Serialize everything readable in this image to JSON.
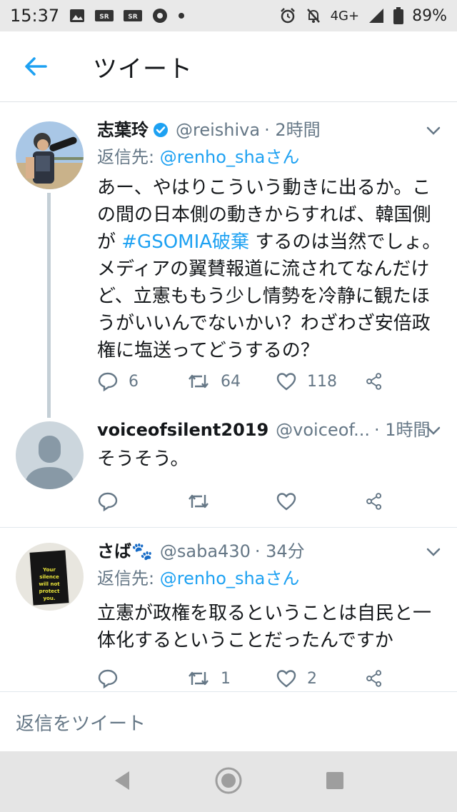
{
  "status_bar": {
    "time": "15:37",
    "network": "4G+",
    "battery": "89%",
    "left_icons": [
      "image-icon",
      "news-app-icon",
      "news-app-icon",
      "chrome-icon",
      "dot-icon"
    ],
    "right_icons": [
      "alarm-icon",
      "mute-icon",
      "signal-icon",
      "battery-icon"
    ]
  },
  "header": {
    "title": "ツイート"
  },
  "tweets": [
    {
      "name": "志葉玲",
      "verified": true,
      "handle": "@reishiva",
      "time": "· 2時間",
      "reply_prefix": "返信先:",
      "reply_to": "@renho_shaさん",
      "text_before": "あー、やはりこういう動きに出るか。この間の日本側の動きからすれば、韓国側が ",
      "hashtag": "#GSOMIA破棄",
      "text_after": " するのは当然でしょ。メディアの翼賛報道に流されてなんだけど、立憲ももう少し情勢を冷静に観たほうがいいんでないかい？わざわざ安倍政権に塩送ってどうするの？",
      "replies": "6",
      "retweets": "64",
      "likes": "118"
    },
    {
      "name": "voiceofsilent2019",
      "handle": "@voiceof...",
      "time": "· 1時間",
      "text": "そうそう。",
      "replies": "",
      "retweets": "",
      "likes": ""
    },
    {
      "name": "さば🐾",
      "handle": "@saba430",
      "time": "· 34分",
      "reply_prefix": "返信先:",
      "reply_to": "@renho_shaさん",
      "text": "立憲が政権を取るということは自民と一体化するということだったんですか",
      "avatar_text": "Your silence will not protect you.",
      "replies": "",
      "retweets": "1",
      "likes": "2"
    }
  ],
  "compose": {
    "placeholder": "返信をツイート"
  },
  "colors": {
    "accent": "#1da1f2",
    "muted": "#657786",
    "text": "#14171a",
    "verified": "#1da1f2"
  }
}
